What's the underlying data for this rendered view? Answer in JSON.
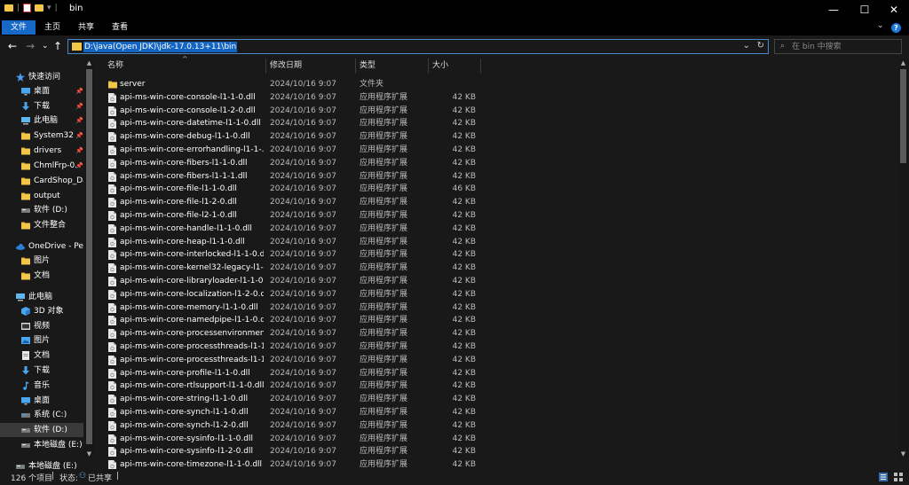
{
  "title": "bin",
  "titlebar": {
    "quick_access_icons": [
      "folder-icon",
      "properties-icon",
      "new-folder-icon",
      "customize-dropdown-icon"
    ],
    "controls": {
      "minimize": "—",
      "maximize": "☐",
      "close": "✕"
    }
  },
  "ribbon": {
    "tabs": [
      {
        "label": "文件",
        "active": true
      },
      {
        "label": "主页",
        "active": false
      },
      {
        "label": "共享",
        "active": false
      },
      {
        "label": "查看",
        "active": false
      }
    ],
    "expand_glyph": "⌄",
    "help_glyph": "?"
  },
  "address": {
    "back": "←",
    "forward": "→",
    "recent": "⌄",
    "up": "↑",
    "path": "D:\\java(Open JDK)\\jdk-17.0.13+11\\bin",
    "dropdown": "⌄",
    "refresh": "↻"
  },
  "search": {
    "placeholder": "在 bin 中搜索",
    "icon": "search-icon"
  },
  "nav": {
    "items": [
      {
        "label": "快速访问",
        "icon": "star-icon",
        "level": 0,
        "pinned": false
      },
      {
        "label": "桌面",
        "icon": "desktop-icon",
        "level": 1,
        "pinned": true
      },
      {
        "label": "下载",
        "icon": "download-icon",
        "level": 1,
        "pinned": true
      },
      {
        "label": "此电脑",
        "icon": "computer-icon",
        "level": 1,
        "pinned": true
      },
      {
        "label": "System32",
        "icon": "folder-icon",
        "level": 1,
        "pinned": true
      },
      {
        "label": "drivers",
        "icon": "folder-icon",
        "level": 1,
        "pinned": true
      },
      {
        "label": "ChmlFrp-0.",
        "icon": "folder-icon",
        "level": 1,
        "pinned": true
      },
      {
        "label": "CardShop_Da",
        "icon": "folder-icon",
        "level": 1,
        "pinned": false
      },
      {
        "label": "output",
        "icon": "folder-icon",
        "level": 1,
        "pinned": false
      },
      {
        "label": "软件 (D:)",
        "icon": "drive-icon",
        "level": 1,
        "pinned": false
      },
      {
        "label": "文件整合",
        "icon": "folder-icon",
        "level": 1,
        "pinned": false
      },
      {
        "label": "OneDrive - Per",
        "icon": "cloud-icon",
        "level": 0,
        "pinned": false
      },
      {
        "label": "图片",
        "icon": "folder-icon",
        "level": 1,
        "pinned": false
      },
      {
        "label": "文档",
        "icon": "folder-icon",
        "level": 1,
        "pinned": false
      },
      {
        "label": "此电脑",
        "icon": "computer-icon",
        "level": 0,
        "pinned": false
      },
      {
        "label": "3D 对象",
        "icon": "cube-icon",
        "level": 1,
        "pinned": false
      },
      {
        "label": "视频",
        "icon": "video-icon",
        "level": 1,
        "pinned": false
      },
      {
        "label": "图片",
        "icon": "pictures-icon",
        "level": 1,
        "pinned": false
      },
      {
        "label": "文档",
        "icon": "documents-icon",
        "level": 1,
        "pinned": false
      },
      {
        "label": "下载",
        "icon": "download-icon",
        "level": 1,
        "pinned": false
      },
      {
        "label": "音乐",
        "icon": "music-icon",
        "level": 1,
        "pinned": false
      },
      {
        "label": "桌面",
        "icon": "desktop-icon",
        "level": 1,
        "pinned": false
      },
      {
        "label": "系统 (C:)",
        "icon": "windows-drive-icon",
        "level": 1,
        "pinned": false
      },
      {
        "label": "软件 (D:)",
        "icon": "drive-icon",
        "level": 1,
        "pinned": false,
        "selected": true
      },
      {
        "label": "本地磁盘 (E:)",
        "icon": "drive-icon",
        "level": 1,
        "pinned": false
      },
      {
        "label": "本地磁盘 (E:)",
        "icon": "drive-icon",
        "level": 0,
        "pinned": false
      }
    ]
  },
  "columns": [
    "名称",
    "修改日期",
    "类型",
    "大小"
  ],
  "files": [
    {
      "name": "server",
      "date": "2024/10/16 9:07",
      "type": "文件夹",
      "size": "",
      "kind": "folder"
    },
    {
      "name": "api-ms-win-core-console-l1-1-0.dll",
      "date": "2024/10/16 9:07",
      "type": "应用程序扩展",
      "size": "42 KB",
      "kind": "dll"
    },
    {
      "name": "api-ms-win-core-console-l1-2-0.dll",
      "date": "2024/10/16 9:07",
      "type": "应用程序扩展",
      "size": "42 KB",
      "kind": "dll"
    },
    {
      "name": "api-ms-win-core-datetime-l1-1-0.dll",
      "date": "2024/10/16 9:07",
      "type": "应用程序扩展",
      "size": "42 KB",
      "kind": "dll"
    },
    {
      "name": "api-ms-win-core-debug-l1-1-0.dll",
      "date": "2024/10/16 9:07",
      "type": "应用程序扩展",
      "size": "42 KB",
      "kind": "dll"
    },
    {
      "name": "api-ms-win-core-errorhandling-l1-1-...",
      "date": "2024/10/16 9:07",
      "type": "应用程序扩展",
      "size": "42 KB",
      "kind": "dll"
    },
    {
      "name": "api-ms-win-core-fibers-l1-1-0.dll",
      "date": "2024/10/16 9:07",
      "type": "应用程序扩展",
      "size": "42 KB",
      "kind": "dll"
    },
    {
      "name": "api-ms-win-core-fibers-l1-1-1.dll",
      "date": "2024/10/16 9:07",
      "type": "应用程序扩展",
      "size": "42 KB",
      "kind": "dll"
    },
    {
      "name": "api-ms-win-core-file-l1-1-0.dll",
      "date": "2024/10/16 9:07",
      "type": "应用程序扩展",
      "size": "46 KB",
      "kind": "dll"
    },
    {
      "name": "api-ms-win-core-file-l1-2-0.dll",
      "date": "2024/10/16 9:07",
      "type": "应用程序扩展",
      "size": "42 KB",
      "kind": "dll"
    },
    {
      "name": "api-ms-win-core-file-l2-1-0.dll",
      "date": "2024/10/16 9:07",
      "type": "应用程序扩展",
      "size": "42 KB",
      "kind": "dll"
    },
    {
      "name": "api-ms-win-core-handle-l1-1-0.dll",
      "date": "2024/10/16 9:07",
      "type": "应用程序扩展",
      "size": "42 KB",
      "kind": "dll"
    },
    {
      "name": "api-ms-win-core-heap-l1-1-0.dll",
      "date": "2024/10/16 9:07",
      "type": "应用程序扩展",
      "size": "42 KB",
      "kind": "dll"
    },
    {
      "name": "api-ms-win-core-interlocked-l1-1-0.dll",
      "date": "2024/10/16 9:07",
      "type": "应用程序扩展",
      "size": "42 KB",
      "kind": "dll"
    },
    {
      "name": "api-ms-win-core-kernel32-legacy-l1-...",
      "date": "2024/10/16 9:07",
      "type": "应用程序扩展",
      "size": "42 KB",
      "kind": "dll"
    },
    {
      "name": "api-ms-win-core-libraryloader-l1-1-0....",
      "date": "2024/10/16 9:07",
      "type": "应用程序扩展",
      "size": "42 KB",
      "kind": "dll"
    },
    {
      "name": "api-ms-win-core-localization-l1-2-0.dll",
      "date": "2024/10/16 9:07",
      "type": "应用程序扩展",
      "size": "42 KB",
      "kind": "dll"
    },
    {
      "name": "api-ms-win-core-memory-l1-1-0.dll",
      "date": "2024/10/16 9:07",
      "type": "应用程序扩展",
      "size": "42 KB",
      "kind": "dll"
    },
    {
      "name": "api-ms-win-core-namedpipe-l1-1-0.dll",
      "date": "2024/10/16 9:07",
      "type": "应用程序扩展",
      "size": "42 KB",
      "kind": "dll"
    },
    {
      "name": "api-ms-win-core-processenvironmen...",
      "date": "2024/10/16 9:07",
      "type": "应用程序扩展",
      "size": "42 KB",
      "kind": "dll"
    },
    {
      "name": "api-ms-win-core-processthreads-l1-1...",
      "date": "2024/10/16 9:07",
      "type": "应用程序扩展",
      "size": "42 KB",
      "kind": "dll"
    },
    {
      "name": "api-ms-win-core-processthreads-l1-1...",
      "date": "2024/10/16 9:07",
      "type": "应用程序扩展",
      "size": "42 KB",
      "kind": "dll"
    },
    {
      "name": "api-ms-win-core-profile-l1-1-0.dll",
      "date": "2024/10/16 9:07",
      "type": "应用程序扩展",
      "size": "42 KB",
      "kind": "dll"
    },
    {
      "name": "api-ms-win-core-rtlsupport-l1-1-0.dll",
      "date": "2024/10/16 9:07",
      "type": "应用程序扩展",
      "size": "42 KB",
      "kind": "dll"
    },
    {
      "name": "api-ms-win-core-string-l1-1-0.dll",
      "date": "2024/10/16 9:07",
      "type": "应用程序扩展",
      "size": "42 KB",
      "kind": "dll"
    },
    {
      "name": "api-ms-win-core-synch-l1-1-0.dll",
      "date": "2024/10/16 9:07",
      "type": "应用程序扩展",
      "size": "42 KB",
      "kind": "dll"
    },
    {
      "name": "api-ms-win-core-synch-l1-2-0.dll",
      "date": "2024/10/16 9:07",
      "type": "应用程序扩展",
      "size": "42 KB",
      "kind": "dll"
    },
    {
      "name": "api-ms-win-core-sysinfo-l1-1-0.dll",
      "date": "2024/10/16 9:07",
      "type": "应用程序扩展",
      "size": "42 KB",
      "kind": "dll"
    },
    {
      "name": "api-ms-win-core-sysinfo-l1-2-0.dll",
      "date": "2024/10/16 9:07",
      "type": "应用程序扩展",
      "size": "42 KB",
      "kind": "dll"
    },
    {
      "name": "api-ms-win-core-timezone-l1-1-0.dll",
      "date": "2024/10/16 9:07",
      "type": "应用程序扩展",
      "size": "42 KB",
      "kind": "dll"
    }
  ],
  "status": {
    "count": "126 个项目",
    "sep": "|",
    "state": "状态:",
    "share": "已共享",
    "sep2": "|"
  },
  "colors": {
    "accent": "#1769c8",
    "background": "#191919",
    "folder": "#f3c648",
    "selection": "#3a3a3a"
  }
}
